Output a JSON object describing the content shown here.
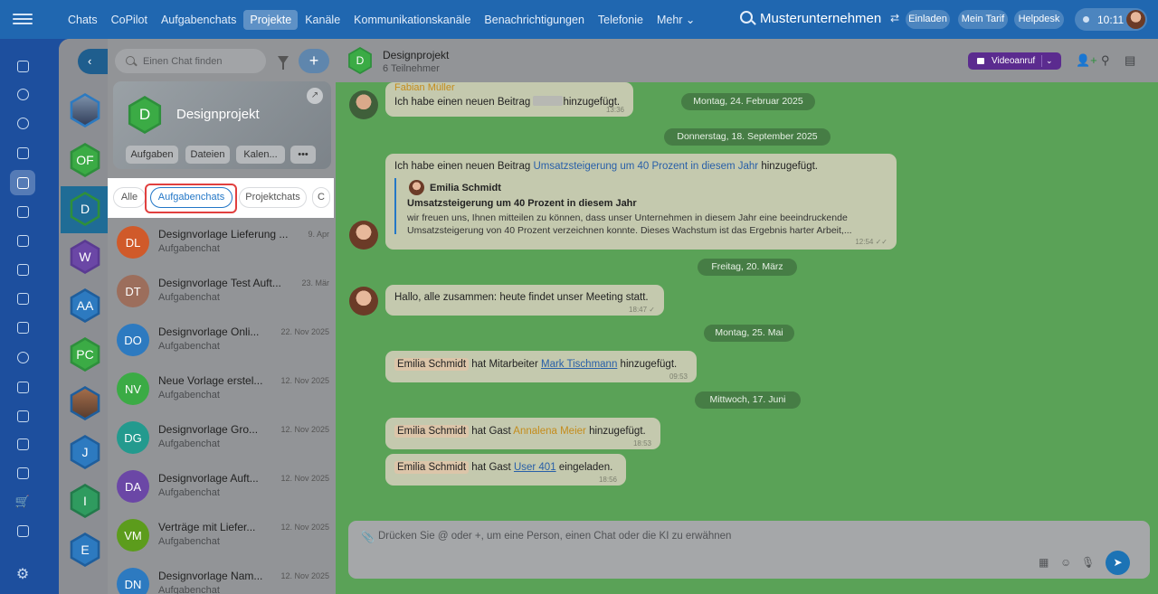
{
  "topnav": {
    "items": [
      "Chats",
      "CoPilot",
      "Aufgabenchats",
      "Projekte",
      "Kanäle",
      "Kommunikationskanäle",
      "Benachrichtigungen",
      "Telefonie",
      "Mehr ⌄"
    ],
    "company": "Musterunternehmen",
    "invite_label": "Einladen",
    "tariff_label": "Mein Tarif",
    "helpdesk_label": "Helpdesk",
    "time": "10:11"
  },
  "colors": {
    "accent": "#2377c7",
    "highlight": "#e1403f",
    "video": "#5b2b8f",
    "chat_bg": "#5aa257"
  },
  "col1": {
    "back_glyph": "‹",
    "avatars": [
      {
        "label": "",
        "color": "#33405c",
        "img": true
      },
      {
        "label": "OF",
        "color": "#3bab45"
      },
      {
        "label": "D",
        "color": "#3bab45"
      },
      {
        "label": "W",
        "color": "#6b47a6"
      },
      {
        "label": "AA",
        "color": "#2d7ac0"
      },
      {
        "label": "PC",
        "color": "#3bab45"
      },
      {
        "label": "",
        "color": "#5a3d2e",
        "img": true
      },
      {
        "label": "J",
        "color": "#2d7ac0"
      },
      {
        "label": "I",
        "color": "#2f9b5f"
      },
      {
        "label": "E",
        "color": "#2d7ac0"
      }
    ]
  },
  "sidebar": {
    "search_placeholder": "Einen Chat finden",
    "add_glyph": "+",
    "card": {
      "hex_label": "D",
      "title": "Designprojekt",
      "buttons": [
        "Aufgaben",
        "Dateien",
        "Kalen...",
        "•••"
      ]
    },
    "tabs": [
      "Alle",
      "Aufgabenchats",
      "Projektchats",
      "C"
    ],
    "chats": [
      {
        "initials": "DL",
        "name": "Designvorlage Lieferung ...",
        "date": "9. Apr",
        "sub": "Aufgabenchat",
        "color": "#d05a2a"
      },
      {
        "initials": "DT",
        "name": "Designvorlage Test Auft...",
        "date": "23. Mär",
        "sub": "Aufgabenchat",
        "color": "#9c6e5c"
      },
      {
        "initials": "DO",
        "name": "Designvorlage Onli...",
        "date": "22. Nov 2025",
        "sub": "Aufgabenchat",
        "color": "#2d7ac0"
      },
      {
        "initials": "NV",
        "name": "Neue Vorlage erstel...",
        "date": "12. Nov 2025",
        "sub": "Aufgabenchat",
        "color": "#3bab45"
      },
      {
        "initials": "DG",
        "name": "Designvorlage Gro...",
        "date": "12. Nov 2025",
        "sub": "Aufgabenchat",
        "color": "#239a8e"
      },
      {
        "initials": "DA",
        "name": "Designvorlage Auft...",
        "date": "12. Nov 2025",
        "sub": "Aufgabenchat",
        "color": "#6b47a6"
      },
      {
        "initials": "VM",
        "name": "Verträge mit Liefer...",
        "date": "12. Nov 2025",
        "sub": "Aufgabenchat",
        "color": "#5c9c1c"
      },
      {
        "initials": "DN",
        "name": "Designvorlage Nam...",
        "date": "12. Nov 2025",
        "sub": "Aufgabenchat",
        "color": "#2d7ac0"
      }
    ]
  },
  "chat": {
    "hex_label": "D",
    "title": "Designprojekt",
    "subtitle": "6 Teilnehmer",
    "video_label": "Videoanruf",
    "video_chevron": "⌄",
    "header_icons": [
      "👤+",
      "⚲",
      "▤"
    ],
    "dates": [
      "Montag, 24. Februar 2025",
      "Donnerstag, 18. September 2025",
      "Freitag, 20. März",
      "Montag, 25. Mai",
      "Mittwoch, 17. Juni"
    ],
    "messages": {
      "m1": {
        "author": "Fabian Müller",
        "pre": "Ich habe einen neuen Beitrag",
        "post": "hinzugefügt.",
        "time": "13:36"
      },
      "m2": {
        "pre": "Ich habe einen neuen Beitrag",
        "link": "Umsatzsteigerung um 40 Prozent in diesem Jahr",
        "post": "hinzugefügt.",
        "quote_author": "Emilia Schmidt",
        "quote_title": "Umsatzsteigerung um 40 Prozent in diesem Jahr",
        "quote_text": "wir freuen uns, Ihnen mitteilen zu können, dass unser Unternehmen in diesem Jahr eine beeindruckende Umsatzsteigerung von 40 Prozent verzeichnen konnte. Dieses Wachstum ist das Ergebnis harter Arbeit,...",
        "time": "12:54 ✓✓"
      },
      "m3": {
        "text": "Hallo, alle zusammen: heute findet unser Meeting statt.",
        "time": "18:47 ✓"
      },
      "m4": {
        "chip": "Emilia Schmidt",
        "mid": "hat Mitarbeiter",
        "link": "Mark Tischmann",
        "post": "hinzugefügt.",
        "time": "09:53"
      },
      "m5": {
        "chip": "Emilia Schmidt",
        "mid": "hat Gast",
        "link": "Annalena Meier",
        "post": "hinzugefügt.",
        "time": "18:53"
      },
      "m6": {
        "chip": "Emilia Schmidt",
        "mid": "hat Gast",
        "link": "User 401",
        "post": "eingeladen.",
        "time": "18:56"
      }
    },
    "input_placeholder": "Drücken Sie @ oder +, um eine Person, einen Chat oder die KI zu erwähnen",
    "input_icons": [
      "▦",
      "☺",
      "🎙"
    ],
    "send_glyph": "➤"
  }
}
